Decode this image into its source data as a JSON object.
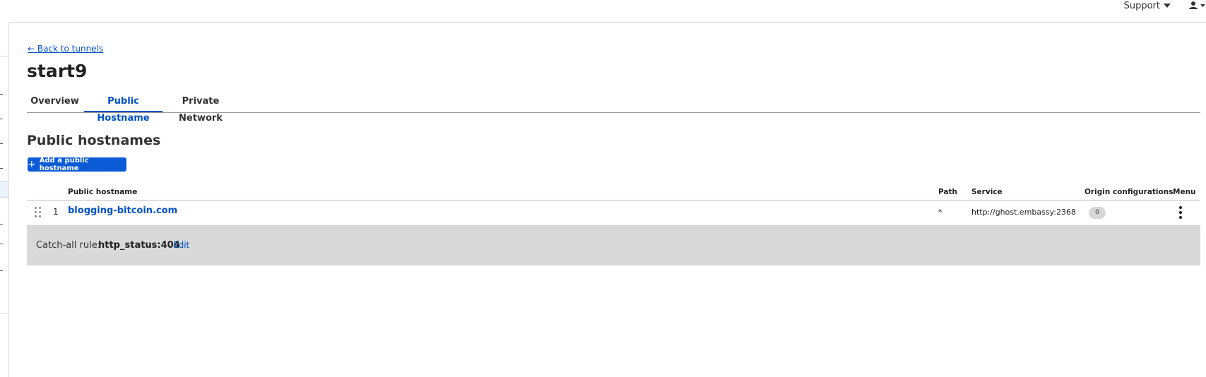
{
  "header": {
    "support_label": "Support"
  },
  "page": {
    "back_link": "← Back to tunnels",
    "title": "start9"
  },
  "tabs": [
    {
      "label": "Overview",
      "active": false
    },
    {
      "label": "Public Hostname",
      "active": true
    },
    {
      "label": "Private Network",
      "active": false
    }
  ],
  "section": {
    "title": "Public hostnames",
    "add_button": "Add a public hostname"
  },
  "table": {
    "columns": {
      "hostname": "Public hostname",
      "path": "Path",
      "service": "Service",
      "origin": "Origin configurations",
      "menu": "Menu"
    },
    "rows": [
      {
        "index": "1",
        "hostname": "blogging-bitcoin.com",
        "path": "*",
        "service": "http://ghost.embassy:2368",
        "origin_count": "0"
      }
    ]
  },
  "catch_all": {
    "label": "Catch-all rule:",
    "value": "http_status:404",
    "edit_label": "Edit"
  },
  "colors": {
    "link_blue": "#0051c3",
    "button_blue": "#0b5bd7",
    "catchall_bg": "#d9d9d9"
  }
}
